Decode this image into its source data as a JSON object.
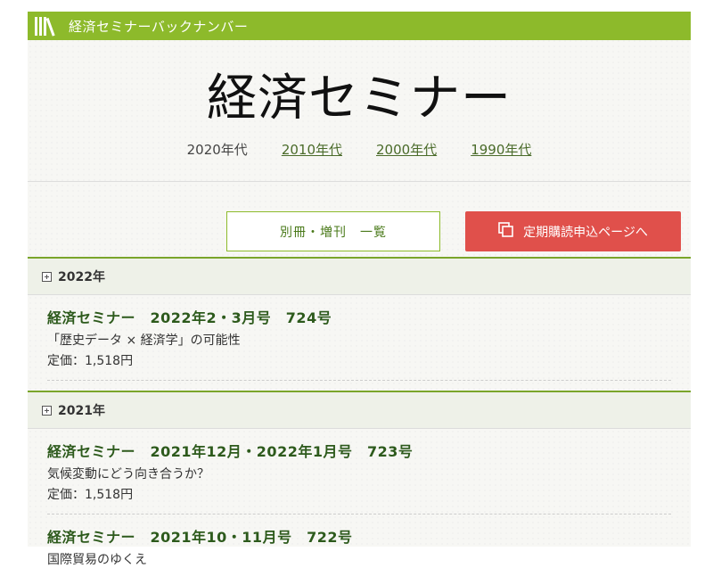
{
  "topbar": {
    "title": "経済セミナーバックナンバー",
    "logo_icon": "bookshelf-icon"
  },
  "header": {
    "brand": "経済セミナー",
    "decades": [
      {
        "label": "2020年代",
        "link": false
      },
      {
        "label": "2010年代",
        "link": true
      },
      {
        "label": "2000年代",
        "link": true
      },
      {
        "label": "1990年代",
        "link": true
      }
    ]
  },
  "buttons": {
    "special": "別冊・増刊　一覧",
    "subscribe": "定期購読申込ページへ",
    "subscribe_icon": "copy-pages-icon"
  },
  "colors": {
    "accent": "#8dba2b",
    "subscribe": "#e0504b",
    "title_green": "#2d5a1c"
  },
  "years": [
    {
      "label": "2022年",
      "issues": [
        {
          "title": "経済セミナー　2022年2・3月号　724号",
          "theme": "「歴史データ × 経済学」の可能性",
          "price": "定価：1,518円"
        }
      ]
    },
    {
      "label": "2021年",
      "issues": [
        {
          "title": "経済セミナー　2021年12月・2022年1月号　723号",
          "theme": "気候変動にどう向き合うか？",
          "price": "定価：1,518円"
        },
        {
          "title": "経済セミナー　2021年10・11月号　722号",
          "theme": "国際貿易のゆくえ",
          "price": ""
        }
      ]
    }
  ]
}
